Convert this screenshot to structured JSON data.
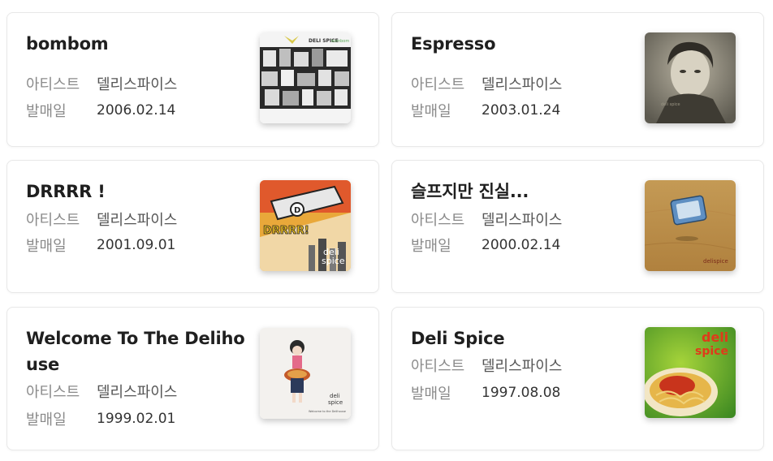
{
  "labels": {
    "artist": "아티스트",
    "release": "발매일"
  },
  "albums": [
    {
      "title": "bombom",
      "artist": "델리스파이스",
      "date": "2006.02.14",
      "cover_text": [
        "DELI SPICE",
        "bombom"
      ]
    },
    {
      "title": "Espresso",
      "artist": "델리스파이스",
      "date": "2003.01.24",
      "cover_text": [
        "deli spice"
      ]
    },
    {
      "title": "DRRRR !",
      "artist": "델리스파이스",
      "date": "2001.09.01",
      "cover_text": [
        "D",
        "DRRRR!",
        "deli",
        "spice"
      ]
    },
    {
      "title": "슬프지만 진실...",
      "artist": "델리스파이스",
      "date": "2000.02.14",
      "cover_text": [
        "delispice"
      ]
    },
    {
      "title": "Welcome To The Delihouse",
      "artist": "델리스파이스",
      "date": "1999.02.01",
      "cover_text": [
        "deli",
        "spice",
        "Welcome to the Delihouse"
      ]
    },
    {
      "title": "Deli Spice",
      "artist": "델리스파이스",
      "date": "1997.08.08",
      "cover_text": [
        "deli",
        "spice"
      ]
    }
  ]
}
